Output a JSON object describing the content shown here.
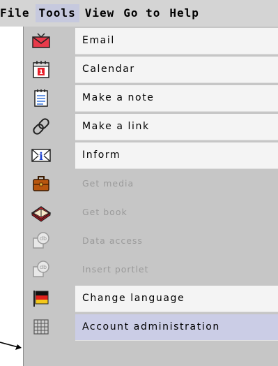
{
  "menubar": {
    "items": [
      {
        "label": "File"
      },
      {
        "label": "Tools",
        "active": true
      },
      {
        "label": "View"
      },
      {
        "label": "Go to"
      },
      {
        "label": "Help"
      }
    ]
  },
  "tools_menu": {
    "items": [
      {
        "label": "Email",
        "icon": "envelope-icon",
        "enabled": true
      },
      {
        "label": "Calendar",
        "icon": "calendar-icon",
        "enabled": true
      },
      {
        "label": "Make a note",
        "icon": "notepad-icon",
        "enabled": true
      },
      {
        "label": "Make a link",
        "icon": "chain-link-icon",
        "enabled": true
      },
      {
        "label": "Inform",
        "icon": "info-envelope-icon",
        "enabled": true
      },
      {
        "label": "Get media",
        "icon": "briefcase-icon",
        "enabled": false
      },
      {
        "label": "Get book",
        "icon": "book-icon",
        "enabled": false
      },
      {
        "label": "Data access",
        "icon": "database-icon",
        "enabled": false
      },
      {
        "label": "Insert portlet",
        "icon": "database-icon",
        "enabled": false
      },
      {
        "label": "Change language",
        "icon": "flag-icon",
        "enabled": true
      },
      {
        "label": "Account administration",
        "icon": "grid-icon",
        "enabled": true,
        "selected": true
      }
    ]
  },
  "colors": {
    "menubar_bg": "#d4d4d4",
    "active_menu_bg": "#c6c9de",
    "dropdown_bg": "#c6c6c6",
    "item_bg": "#f4f4f4",
    "selected_bg": "#cbcde6",
    "disabled_text": "#9a9a9a"
  }
}
